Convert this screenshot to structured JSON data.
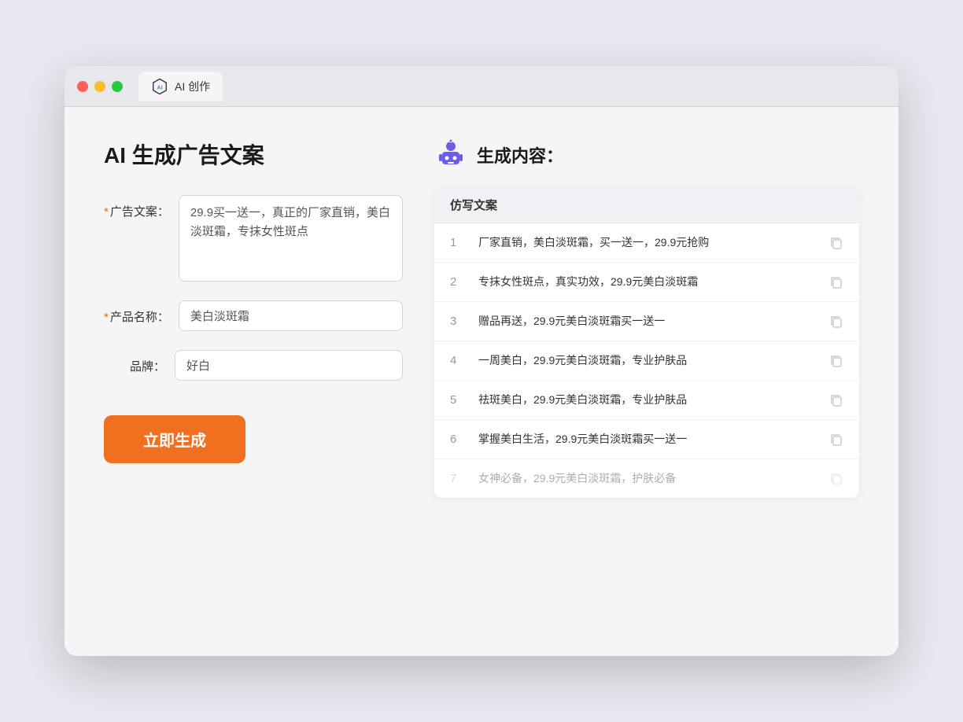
{
  "browser": {
    "tab_label": "AI 创作"
  },
  "left": {
    "page_title": "AI 生成广告文案",
    "fields": [
      {
        "id": "ad_copy",
        "label": "广告文案：",
        "required": true,
        "type": "textarea",
        "value": "29.9买一送一，真正的厂家直销，美白淡斑霜，专抹女性斑点"
      },
      {
        "id": "product_name",
        "label": "产品名称：",
        "required": true,
        "type": "input",
        "value": "美白淡斑霜"
      },
      {
        "id": "brand",
        "label": "品牌：",
        "required": false,
        "type": "input",
        "value": "好白"
      }
    ],
    "generate_button": "立即生成"
  },
  "right": {
    "title": "生成内容：",
    "table_header": "仿写文案",
    "results": [
      {
        "num": "1",
        "text": "厂家直销，美白淡斑霜，买一送一，29.9元抢购",
        "dimmed": false
      },
      {
        "num": "2",
        "text": "专抹女性斑点，真实功效，29.9元美白淡斑霜",
        "dimmed": false
      },
      {
        "num": "3",
        "text": "赠品再送，29.9元美白淡斑霜买一送一",
        "dimmed": false
      },
      {
        "num": "4",
        "text": "一周美白，29.9元美白淡斑霜，专业护肤品",
        "dimmed": false
      },
      {
        "num": "5",
        "text": "祛斑美白，29.9元美白淡斑霜，专业护肤品",
        "dimmed": false
      },
      {
        "num": "6",
        "text": "掌握美白生活，29.9元美白淡斑霜买一送一",
        "dimmed": false
      },
      {
        "num": "7",
        "text": "女神必备，29.9元美白淡斑霜，护肤必备",
        "dimmed": true
      }
    ]
  }
}
